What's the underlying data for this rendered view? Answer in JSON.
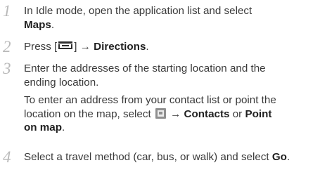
{
  "steps": [
    {
      "number": "1",
      "line1": "In Idle mode, open the application list and select",
      "line2_bold": "Maps",
      "line2_suffix": "."
    },
    {
      "number": "2",
      "prefix": "Press [",
      "key_icon": "menu-key-icon",
      "middle": "] → ",
      "bold": "Directions",
      "suffix": "."
    },
    {
      "number": "3",
      "line1": "Enter the addresses of the starting location and the",
      "line2": "ending location.",
      "note_line1": "To enter an address from your contact list or point the",
      "note_line2_prefix": "location on the map, select ",
      "note_icon": "contacts-icon",
      "note_arrow": " → ",
      "note_bold1": "Contacts",
      "note_or": " or ",
      "note_bold2_a": "Point",
      "note_bold2_b": "on map",
      "note_suffix": "."
    },
    {
      "number": "4",
      "prefix": "Select a travel method (car, bus, or walk) and select ",
      "bold": "Go",
      "suffix": "."
    }
  ]
}
